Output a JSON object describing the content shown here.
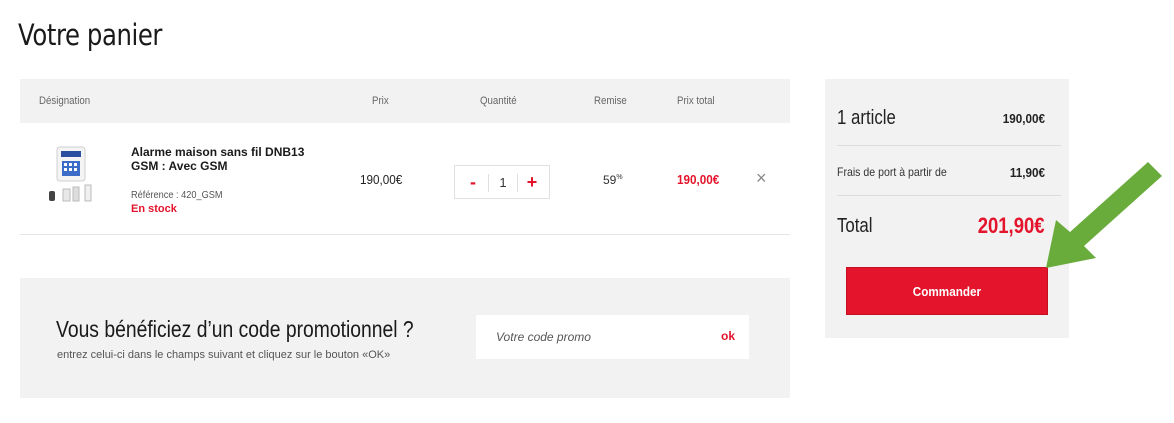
{
  "page": {
    "title": "Votre panier"
  },
  "cart": {
    "headers": {
      "designation": "Désignation",
      "prix": "Prix",
      "quantite": "Quantité",
      "remise": "Remise",
      "prix_total": "Prix total"
    },
    "items": [
      {
        "name": "Alarme maison sans fil DNB13 GSM : Avec GSM",
        "reference": "Référence : 420_GSM",
        "stock": "En stock",
        "price": "190,00€",
        "quantity": "1",
        "minus_label": "-",
        "plus_label": "+",
        "remise": "59",
        "remise_unit": "%",
        "total": "190,00€",
        "remove_label": "×"
      }
    ]
  },
  "promo": {
    "title": "Vous bénéficiez d’un code promotionnel ?",
    "subtitle": "entrez celui-ci dans le champs suivant et cliquez sur le bouton «OK»",
    "placeholder": "Votre code promo",
    "ok_label": "ok"
  },
  "summary": {
    "articles_label": "1 article",
    "articles_value": "190,00€",
    "shipping_label": "Frais de port à partir de",
    "shipping_value": "11,90€",
    "total_label": "Total",
    "total_value": "201,90€",
    "order_label": "Commander"
  },
  "colors": {
    "accent": "#e3142b",
    "panel": "#f2f2f2",
    "arrow": "#6aac3c"
  },
  "icons": {
    "remove": "close-icon",
    "annotation": "arrow-icon"
  }
}
